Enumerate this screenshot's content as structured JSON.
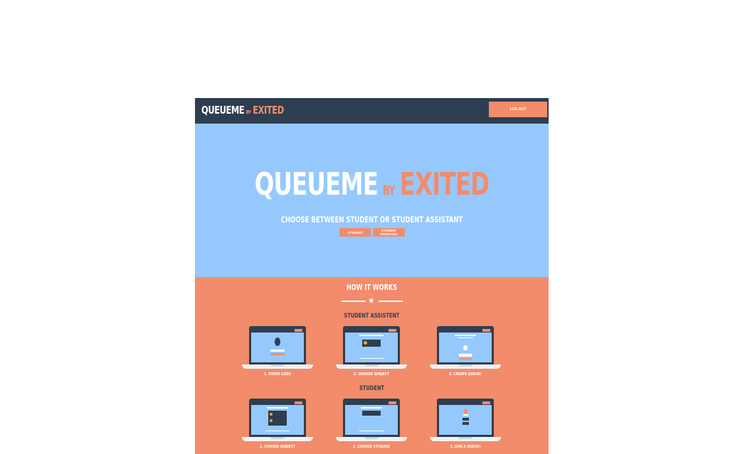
{
  "navbar": {
    "brand_main": "QUEUEME",
    "brand_by": "BY",
    "brand_accent": "EXITED",
    "logout_label": "LOG OUT"
  },
  "hero": {
    "title_main": "QUEUEME",
    "title_by": "BY",
    "title_accent": "EXITED",
    "subtitle": "CHOOSE BETWEEN STUDENT OR STUDENT ASSISTANT",
    "buttons": [
      "STUDENT",
      "STUDENT ASSISTANT"
    ]
  },
  "how_it_works": {
    "title": "HOW IT WORKS",
    "divider_icon": "star-icon",
    "student_assistent": {
      "heading": "STUDENT ASSISTENT",
      "steps": [
        "1. ENTER CODE",
        "2. CHOOSE SUBJECT",
        "3. CREATE QUEUE!"
      ]
    },
    "student": {
      "heading": "STUDENT",
      "steps": [
        "1. CHOOSE SUBJECT",
        "2. CHOOSE STUDASS",
        "3. JOIN A QUEUE!"
      ]
    }
  },
  "colors": {
    "navy": "#2e3e50",
    "sky": "#95c9fd",
    "coral": "#f28c6b",
    "white": "#ffffff"
  }
}
